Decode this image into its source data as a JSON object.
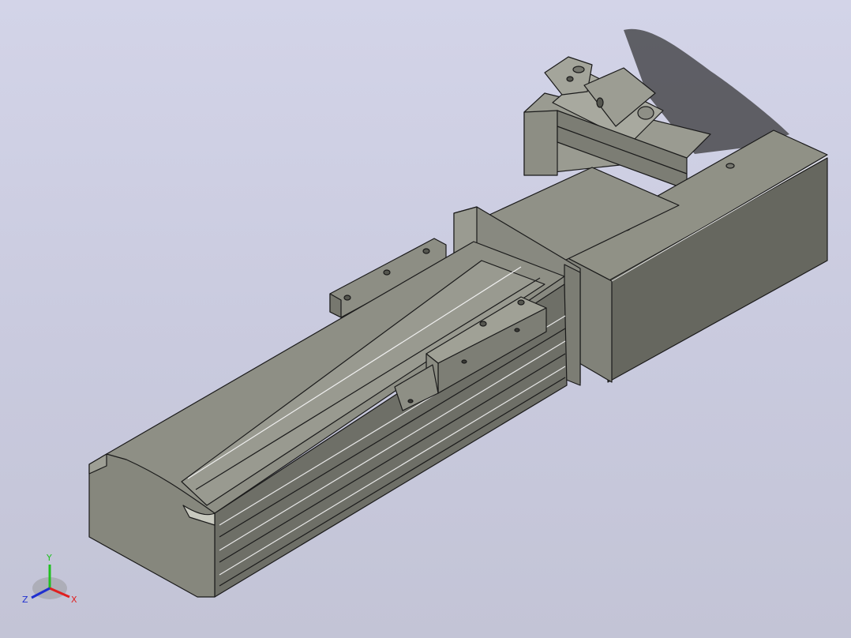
{
  "viewport": {
    "background_top": "#d3d4e8",
    "background_bottom": "#c3c4d6"
  },
  "model": {
    "body_color": "#8b8c82",
    "body_dark": "#5f605a",
    "body_light": "#a4a59b",
    "edge_color": "#1a1a1a"
  },
  "triad": {
    "x_label": "X",
    "y_label": "Y",
    "z_label": "Z",
    "x_color": "#e02020",
    "y_color": "#20c020",
    "z_color": "#2030d0"
  }
}
